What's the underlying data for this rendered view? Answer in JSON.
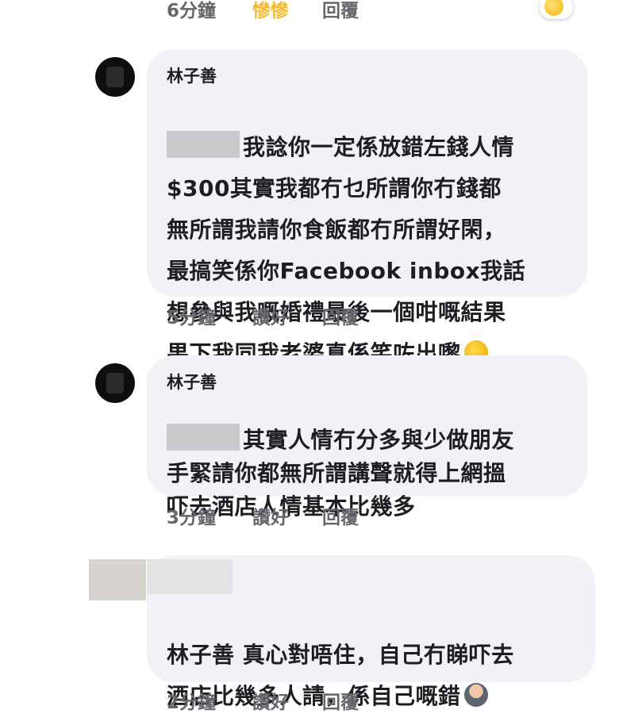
{
  "top_actions": {
    "time": "6分鐘",
    "reaction": "慘慘",
    "reply": "回覆"
  },
  "comments": [
    {
      "author": "林子善",
      "text": "我諗你一定係放錯左錢人情\n$300其實我都冇乜所謂你冇錢都\n無所謂我請你食飯都冇所謂好閑，\n最搞笑係你Facebook inbox我話\n想參與我嘅婚禮最後一個咁嘅結果\n果下我同我老婆真係笑咗出嚟",
      "time": "5分鐘",
      "like": "讚好",
      "reply": "回覆"
    },
    {
      "author": "林子善",
      "text": "其實人情冇分多與少做朋友\n手緊請你都無所謂講聲就得上網搵\n吓去酒店人情基本比幾多",
      "time": "3分鐘",
      "like": "讚好",
      "reply": "回覆"
    },
    {
      "author": "",
      "text": "林子善 真心對唔住，自己冇睇吓去\n酒店比幾多人請，係自己嘅錯",
      "time": "2分鐘",
      "like": "讚好",
      "reply": "回覆"
    }
  ],
  "icons": {
    "reaction_emoji": "sad-face-icon",
    "laugh_emoji": "rolling-laughing-emoji-icon",
    "apology_emoji": "person-bowing-emoji-icon"
  }
}
